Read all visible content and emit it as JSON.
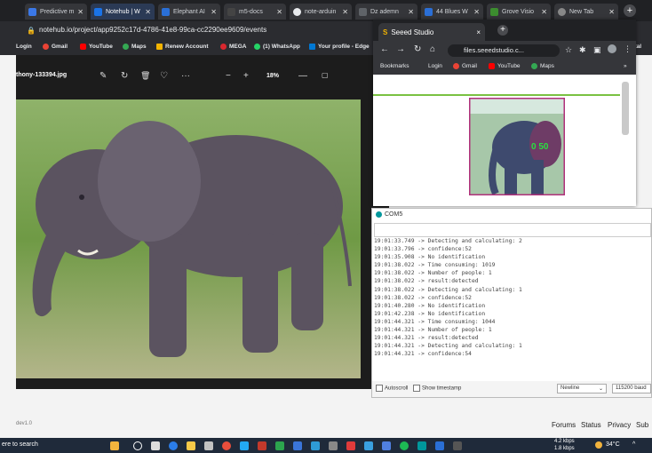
{
  "browser": {
    "tabs": [
      {
        "label": "Predictive m",
        "color": "#3b78e7"
      },
      {
        "label": "Notehub | W",
        "color": "#1a73e8"
      },
      {
        "label": "Elephant AI",
        "color": "#2a6fd6"
      },
      {
        "label": "m5-docs",
        "color": "#444444"
      },
      {
        "label": "note-arduin",
        "color": "#e8eaed"
      },
      {
        "label": "Dz ademn",
        "color": "#5f6368"
      },
      {
        "label": "44 Blues W",
        "color": "#2b6fd6"
      },
      {
        "label": "Grove Visio",
        "color": "#3c8d2f"
      },
      {
        "label": "New Tab",
        "color": "#888888"
      }
    ],
    "new_tab_symbol": "+",
    "url": "notehub.io/project/app9252c17d-4786-41e8-99ca-cc2290ee9609/events",
    "bookmarks": [
      "Login",
      "Gmail",
      "YouTube",
      "Maps",
      "Renew Account",
      "MEGA",
      "(1) WhatsApp",
      "Your profile - Edge",
      "ortal"
    ]
  },
  "viewer": {
    "filename": "thony-133394.jpg",
    "zoom": "18%",
    "edit_icon": "✎",
    "rotate_icon": "↻",
    "delete_icon": "🗑",
    "favorite_icon": "♡",
    "more_icon": "···",
    "zoom_out_icon": "−",
    "zoom_in_icon": "+",
    "minimize": "—",
    "maximize": "▢"
  },
  "small_browser": {
    "tab_title": "Seeed Studio",
    "tab_close": "×",
    "url": "files.seeedstudio.c...",
    "bookmarks": [
      "Bookmarks",
      "Login",
      "Gmail",
      "YouTube",
      "Maps"
    ],
    "overflow": "»",
    "detection_label": "0 50"
  },
  "serial": {
    "title": "COM5",
    "log": [
      "19:01:33.749 -> Detecting and calculating: 2",
      "19:01:33.796 -> confidence:52",
      "19:01:35.908 -> No identification",
      "19:01:38.022 -> Time consuming: 1019",
      "19:01:38.022 -> Number of people: 1",
      "19:01:38.022 -> result:detected",
      "19:01:38.022 -> Detecting and calculating: 1",
      "19:01:38.022 -> confidence:52",
      "19:01:40.280 -> No identification",
      "19:01:42.238 -> No identification",
      "19:01:44.321 -> Time consuming: 1044",
      "19:01:44.321 -> Number of people: 1",
      "19:01:44.321 -> result:detected",
      "19:01:44.321 -> Detecting and calculating: 1",
      "19:01:44.321 -> confidence:54"
    ],
    "autoscroll": "Autoscroll",
    "timestamp": "Show timestamp",
    "line_ending": "Newline",
    "baud": "115200 baud"
  },
  "page_footer": {
    "left_text": "dev1.0",
    "links": [
      "Forums",
      "Status",
      "Privacy",
      "Sub"
    ]
  },
  "taskbar": {
    "search": "ere to search",
    "network": "4.2 kbps",
    "network2": "1.8 kbps",
    "temp": "34°C",
    "tray": "^"
  }
}
